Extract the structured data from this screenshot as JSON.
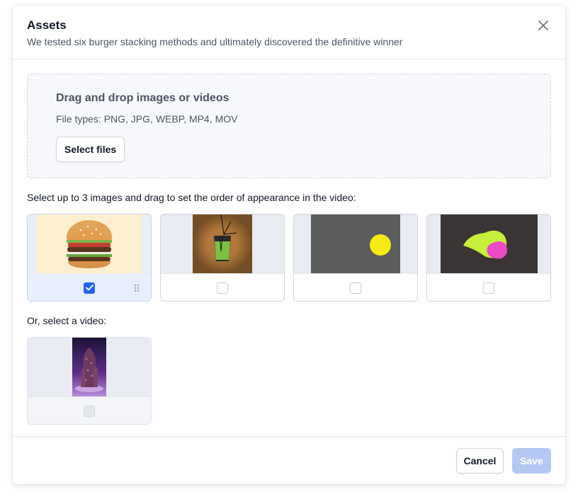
{
  "modal": {
    "title": "Assets",
    "subtitle": "We tested six burger stacking methods and ultimately discovered the definitive winner",
    "close_icon": "close-icon"
  },
  "dropzone": {
    "title": "Drag and drop images or videos",
    "file_types": "File types: PNG, JPG, WEBP, MP4, MOV",
    "select_button": "Select files"
  },
  "images_section": {
    "label": "Select up to 3 images and drag to set the order of appearance in the video:",
    "items": [
      {
        "name": "burger",
        "checked": true,
        "drag_icon": "drag-handle-icon"
      },
      {
        "name": "green-drink",
        "checked": false
      },
      {
        "name": "yellow-dot",
        "checked": false
      },
      {
        "name": "abstract-blob",
        "checked": false
      }
    ]
  },
  "video_section": {
    "label": "Or, select a video:",
    "items": [
      {
        "name": "tower-video",
        "checked": false,
        "disabled": true
      }
    ]
  },
  "footer": {
    "cancel_label": "Cancel",
    "save_label": "Save"
  },
  "colors": {
    "accent": "#2563eb",
    "save_disabled": "#b4c8f3"
  }
}
